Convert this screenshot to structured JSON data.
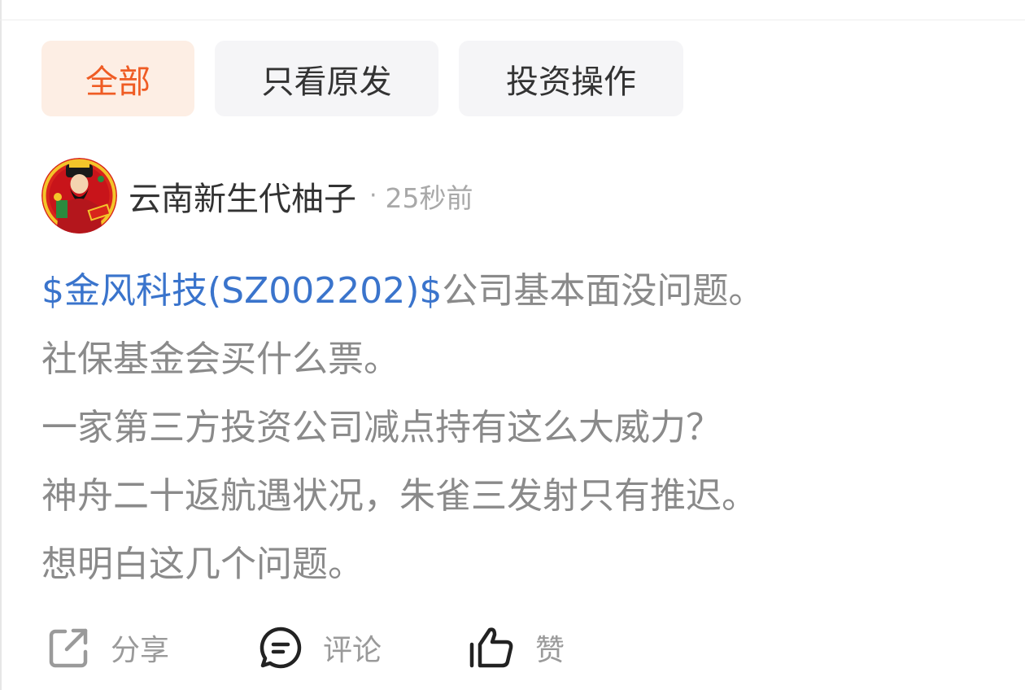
{
  "filters": {
    "tabs": [
      {
        "label": "全部",
        "active": true
      },
      {
        "label": "只看原发",
        "active": false
      },
      {
        "label": "投资操作",
        "active": false
      }
    ],
    "active_color": "#ef5c24"
  },
  "post": {
    "author": "云南新生代柚子",
    "separator": "·",
    "time": "25秒前",
    "stock_tag": "$金风科技(SZ002202)$",
    "lines": [
      "公司基本面没问题。",
      "社保基金会买什么票。",
      "一家第三方投资公司减点持有这么大威力？",
      "神舟二十返航遇状况，朱雀三发射只有推迟。",
      "想明白这几个问题。"
    ],
    "link_color": "#3a74cc"
  },
  "actions": {
    "share": {
      "label": "分享",
      "icon": "share-icon"
    },
    "comment": {
      "label": "评论",
      "icon": "comment-icon"
    },
    "like": {
      "label": "赞",
      "icon": "thumbs-up-icon"
    }
  }
}
